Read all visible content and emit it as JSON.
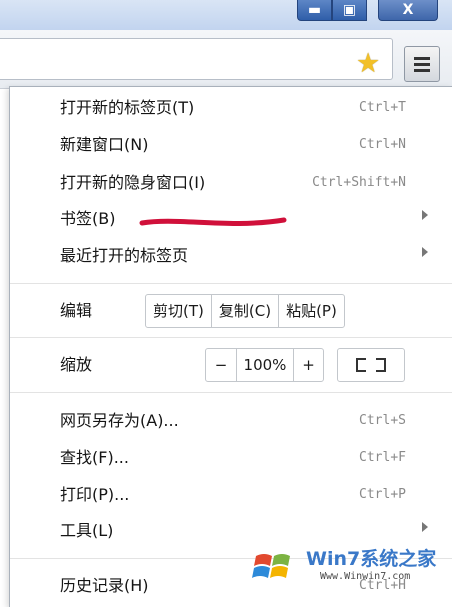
{
  "window": {
    "minimize_glyph": "▬",
    "maximize_glyph": "▣",
    "close_glyph": "X"
  },
  "toolbar": {
    "bookmark_star_icon": "star-icon",
    "menu_icon": "hamburger-icon"
  },
  "menu": {
    "new_tab": {
      "label": "打开新的标签页(T)",
      "accel": "Ctrl+T"
    },
    "new_window": {
      "label": "新建窗口(N)",
      "accel": "Ctrl+N"
    },
    "incognito": {
      "label": "打开新的隐身窗口(I)",
      "accel": "Ctrl+Shift+N"
    },
    "bookmarks": {
      "label": "书签(B)"
    },
    "recent_tabs": {
      "label": "最近打开的标签页"
    },
    "edit": {
      "label": "编辑",
      "cut": "剪切(T)",
      "copy": "复制(C)",
      "paste": "粘贴(P)"
    },
    "zoom": {
      "label": "缩放",
      "minus": "−",
      "value": "100%",
      "plus": "+"
    },
    "save_as": {
      "label": "网页另存为(A)...",
      "accel": "Ctrl+S"
    },
    "find": {
      "label": "查找(F)...",
      "accel": "Ctrl+F"
    },
    "print": {
      "label": "打印(P)...",
      "accel": "Ctrl+P"
    },
    "tools": {
      "label": "工具(L)"
    },
    "history": {
      "label": "历史记录(H)",
      "accel": "Ctrl+H"
    }
  },
  "watermark": {
    "title": "Win7系统之家",
    "url": "Www.Winwin7.com"
  },
  "colors": {
    "annotation_stroke": "#d0103a",
    "accent": "#2f5ea9"
  }
}
